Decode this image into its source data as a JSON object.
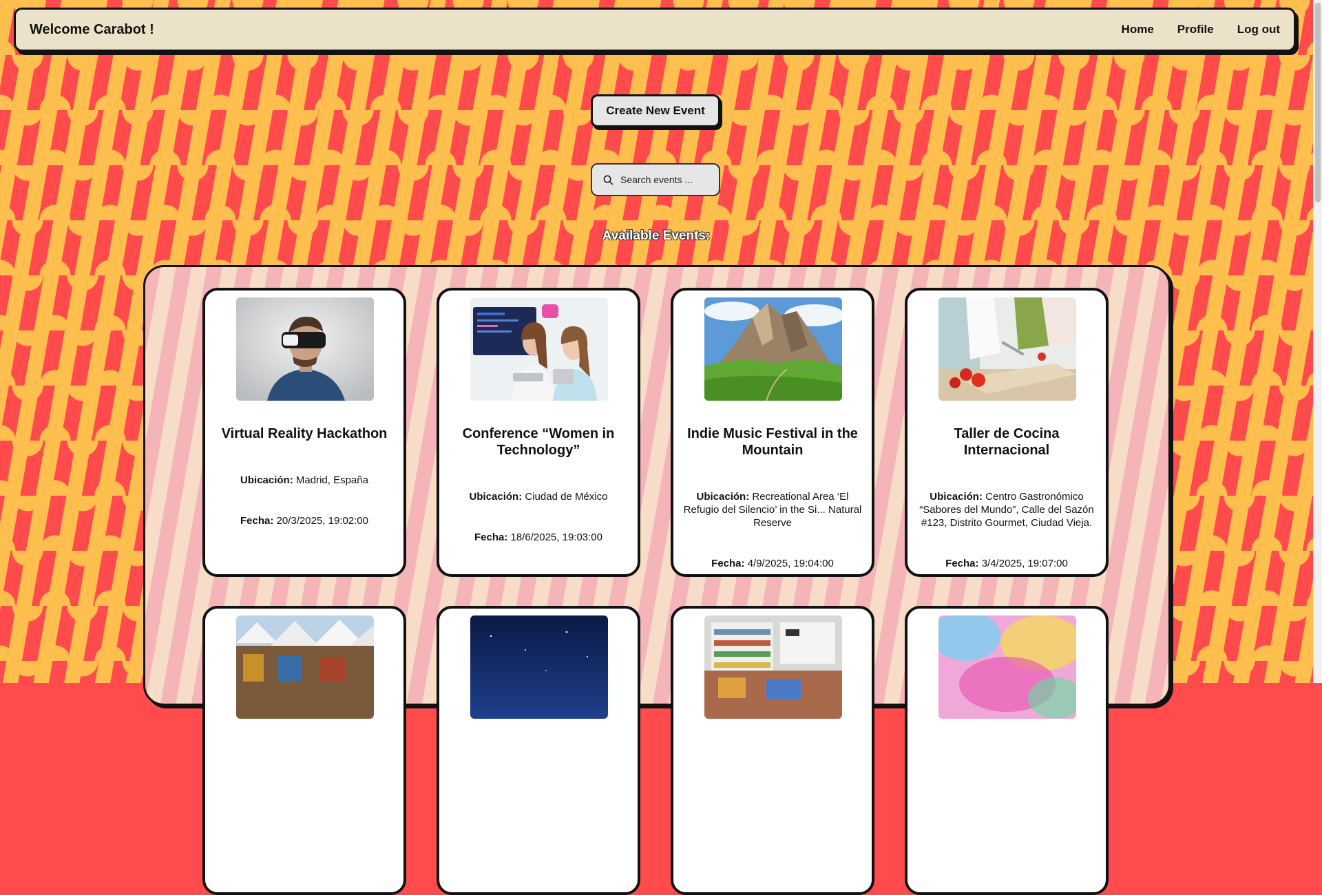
{
  "navbar": {
    "welcome": "Welcome Carabot !",
    "links": [
      "Home",
      "Profile",
      "Log out"
    ]
  },
  "actions": {
    "create_label": "Create New Event"
  },
  "search": {
    "placeholder": "Search events ..."
  },
  "section_title": "Available Events:",
  "labels": {
    "location": "Ubicación:",
    "date": "Fecha:"
  },
  "events": [
    {
      "title": "Virtual Reality Hackathon",
      "location": "Madrid, España",
      "date": "20/3/2025, 19:02:00",
      "image": "person-with-vr-headset"
    },
    {
      "title": "Conference “Women in Technology”",
      "location": "Ciudad de México",
      "date": "18/6/2025, 19:03:00",
      "image": "two-women-with-laptops"
    },
    {
      "title": "Indie Music Festival in the Mountain",
      "location": "Recreational Area ‘El Refugio del Silencio’ in the Si... Natural Reserve",
      "date": "4/9/2025, 19:04:00",
      "image": "mountain-landscape"
    },
    {
      "title": "Taller de Cocina Internacional",
      "location": "Centro Gastronómico “Sabores del Mundo”, Calle del Sazón #123, Distrito Gourmet, Ciudad Vieja.",
      "date": "3/4/2025, 19:07:00",
      "image": "people-cooking-vegetables"
    },
    {
      "image": "market-tents"
    },
    {
      "image": "starry-night-sky"
    },
    {
      "image": "bookstore-shelves"
    },
    {
      "image": "color-powder-festival"
    }
  ],
  "colors": {
    "background_red": "#ff4b4b",
    "background_yellow": "#ffbf4f",
    "navbar_bg": "#ece1c9",
    "panel_pink": "#f4b4b8",
    "button_bg": "#e6e6e6",
    "card_bg": "#ffffff",
    "border": "#111111"
  }
}
